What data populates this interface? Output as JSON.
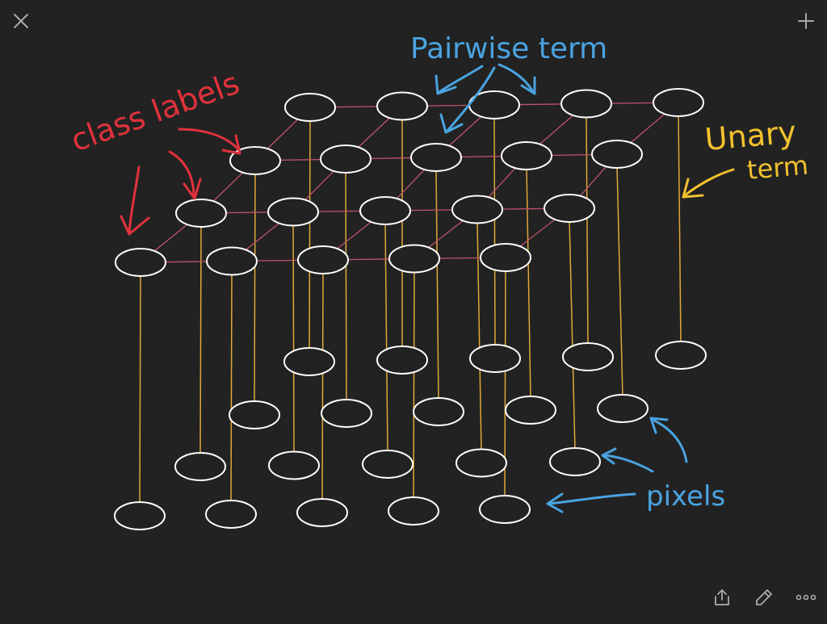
{
  "toolbar": {
    "close_icon": "close-icon",
    "add_icon": "plus-icon",
    "share_icon": "share-icon",
    "pen_icon": "pencil-icon",
    "more_icon": "more-icon"
  },
  "annotations": {
    "class_labels": "class labels",
    "pairwise": "Pairwise term",
    "unary_line1": "Unary",
    "unary_line2": "term",
    "pixels": "pixels"
  },
  "colors": {
    "background": "#222222",
    "node": "#ffffff",
    "edge_pairwise": "#c0536a",
    "edge_unary": "#e0a83a",
    "class_labels": "#e0323c",
    "pairwise": "#4aa3e0",
    "unary": "#f2c12e",
    "pixels": "#4aa3e0",
    "ui_icon": "#aaaaaa"
  }
}
